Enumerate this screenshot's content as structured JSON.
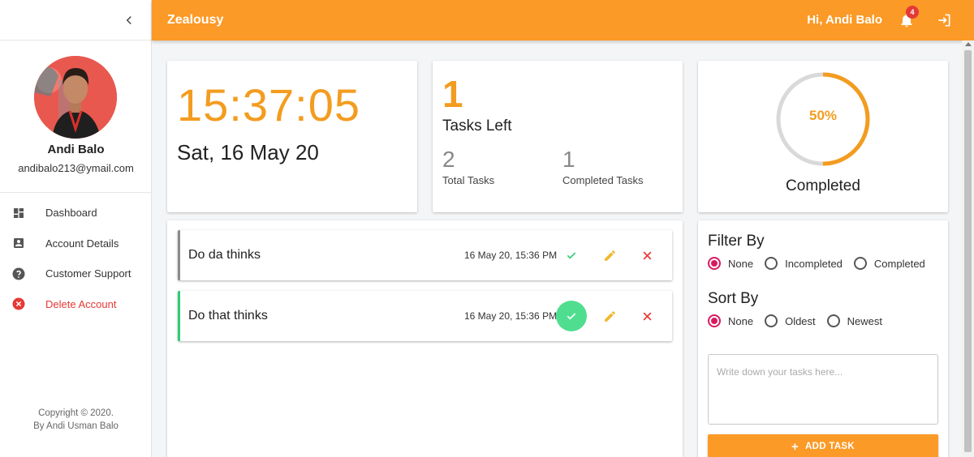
{
  "sidebar": {
    "user": {
      "name": "Andi Balo",
      "email": "andibalo213@ymail.com"
    },
    "nav": [
      {
        "label": "Dashboard",
        "icon": "dashboard-icon"
      },
      {
        "label": "Account Details",
        "icon": "account-box-icon"
      },
      {
        "label": "Customer Support",
        "icon": "help-circle-icon"
      },
      {
        "label": "Delete Account",
        "icon": "cancel-circle-icon"
      }
    ],
    "copyright_line1": "Copyright © 2020.",
    "copyright_line2": "By Andi Usman Balo"
  },
  "header": {
    "title": "Zealousy",
    "greeting": "Hi, Andi Balo",
    "notification_count": "4"
  },
  "clock": {
    "time": "15:37:05",
    "date": "Sat, 16 May 20"
  },
  "stats": {
    "tasks_left": "1",
    "tasks_left_label": "Tasks Left",
    "total": "2",
    "total_label": "Total Tasks",
    "completed": "1",
    "completed_label": "Completed Tasks"
  },
  "progress": {
    "percent_text": "50%",
    "fraction": 0.5,
    "label": "Completed"
  },
  "tasks": [
    {
      "title": "Do da thinks",
      "date": "16 May 20, 15:36 PM",
      "done": false
    },
    {
      "title": "Do that thinks",
      "date": "16 May 20, 15:36 PM",
      "done": true
    }
  ],
  "filter": {
    "title": "Filter By",
    "options": [
      "None",
      "Incompleted",
      "Completed"
    ],
    "selected": "None"
  },
  "sort": {
    "title": "Sort By",
    "options": [
      "None",
      "Oldest",
      "Newest"
    ],
    "selected": "None"
  },
  "new_task": {
    "placeholder": "Write down your tasks here...",
    "value": ""
  },
  "add_button_label": "ADD TASK",
  "colors": {
    "accent": "#fb9a26",
    "accent_text": "#f39c1f",
    "success": "#2ecc71",
    "check_bg": "#4fde8f",
    "danger": "#e53935",
    "radio": "#d81b60",
    "edit": "#f1b82d"
  }
}
